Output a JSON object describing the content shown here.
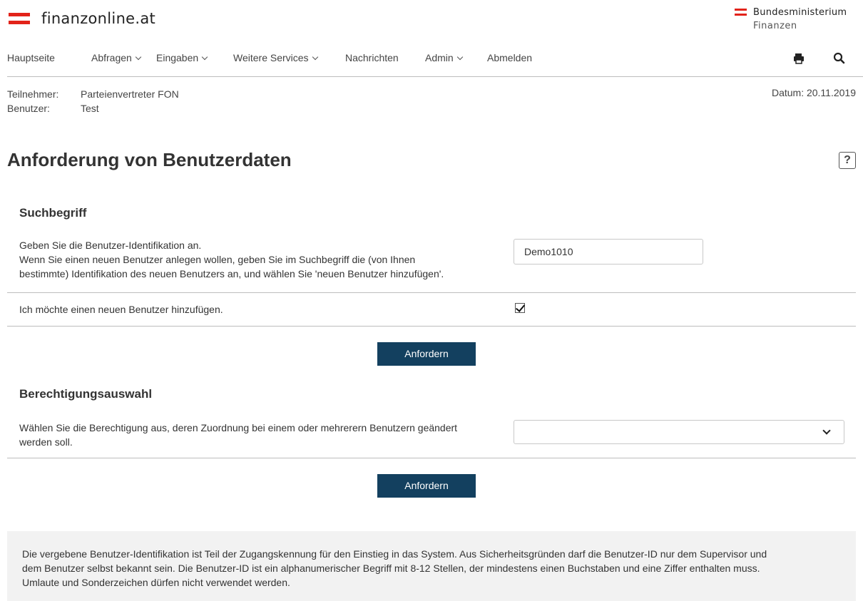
{
  "header": {
    "logo_text": "finanzonline.at",
    "ministry_line1": "Bundesministerium",
    "ministry_line2": "Finanzen",
    "brand_color": "#e2231a"
  },
  "nav": {
    "items": [
      {
        "label": "Hauptseite",
        "has_dropdown": false
      },
      {
        "label": "Abfragen",
        "has_dropdown": true
      },
      {
        "label": "Eingaben",
        "has_dropdown": true
      },
      {
        "label": "Weitere Services",
        "has_dropdown": true
      },
      {
        "label": "Nachrichten",
        "has_dropdown": false
      },
      {
        "label": "Admin",
        "has_dropdown": true
      },
      {
        "label": "Abmelden",
        "has_dropdown": false
      }
    ],
    "icons": [
      "print-icon",
      "search-icon"
    ]
  },
  "info": {
    "teilnehmer_label": "Teilnehmer:",
    "teilnehmer_value": "Parteienvertreter FON",
    "benutzer_label": "Benutzer:",
    "benutzer_value": "Test",
    "datum": "Datum: 20.11.2019"
  },
  "page_title": "Anforderung von Benutzerdaten",
  "help_label": "?",
  "suchbegriff": {
    "heading": "Suchbegriff",
    "description_line1": "Geben Sie die Benutzer-Identifikation an.",
    "description_line2": "Wenn Sie einen neuen Benutzer anlegen wollen, geben Sie im Suchbegriff die (von Ihnen",
    "description_line3": "bestimmte) Identifikation des neuen Benutzers an, und wählen Sie 'neuen Benutzer hinzufügen'.",
    "input_value": "Demo1010",
    "checkbox_label": "Ich möchte einen neuen Benutzer hinzufügen.",
    "checkbox_checked": true,
    "button_label": "Anfordern"
  },
  "berechtigung": {
    "heading": "Berechtigungsauswahl",
    "description_line1": "Wählen Sie die Berechtigung aus, deren Zuordnung bei einem oder mehrerern Benutzern geändert",
    "description_line2": "werden soll.",
    "select_value": "",
    "button_label": "Anfordern"
  },
  "footer_note": {
    "line1": "Die vergebene Benutzer-Identifikation ist Teil der Zugangskennung für den Einstieg in das System. Aus Sicherheitsgründen darf die Benutzer-ID nur dem Supervisor und",
    "line2": "dem Benutzer selbst bekannt sein. Die Benutzer-ID ist ein alphanumerischer Begriff mit 8-12 Stellen, der mindestens einen Buchstaben und eine Ziffer enthalten muss.",
    "line3": "Umlaute und Sonderzeichen dürfen nicht verwendet werden."
  },
  "colors": {
    "button_bg": "#13405f",
    "footer_bg": "#f2f2f2"
  }
}
